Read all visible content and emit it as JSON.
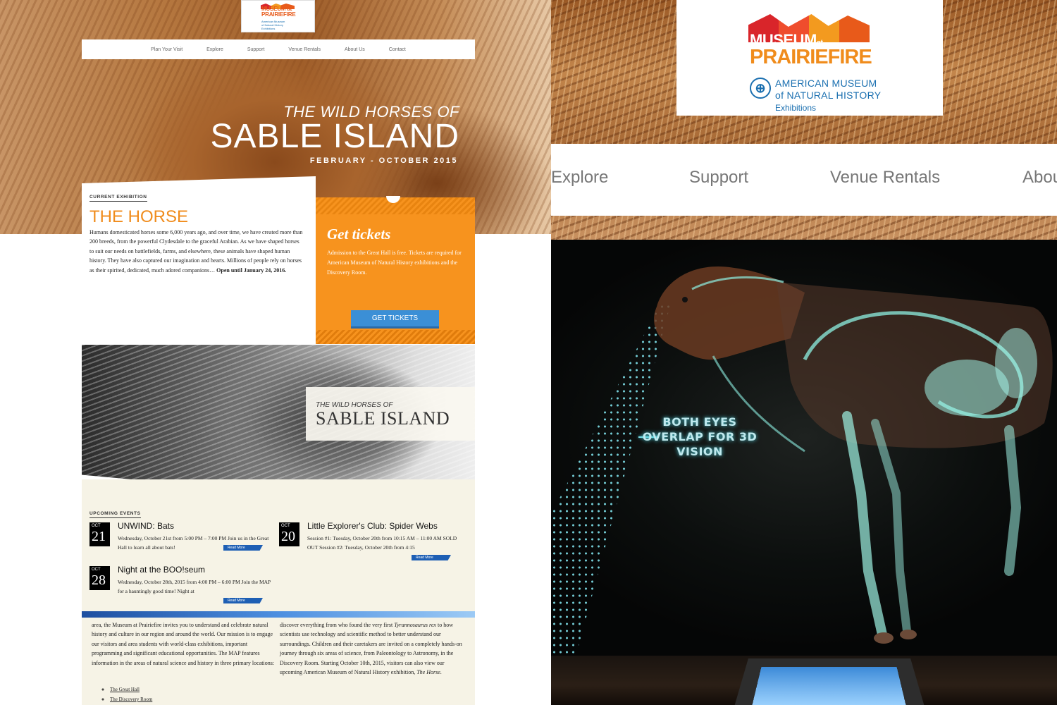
{
  "left": {
    "logo": {
      "museum": "MUSEUM",
      "at": "at",
      "prairiefire": "PRAIRIEFIRE",
      "amnh_line1": "American Museum",
      "amnh_line2": "of Natural History",
      "amnh_line3": "Exhibitions"
    },
    "nav": [
      "Plan Your Visit",
      "Explore",
      "Support",
      "Venue Rentals",
      "About Us",
      "Contact"
    ],
    "hero": {
      "subtitle": "THE WILD HORSES OF",
      "title": "SABLE ISLAND",
      "dates": "FEBRUARY - OCTOBER 2015"
    },
    "exhibition": {
      "label": "CURRENT EXHIBITION",
      "title": "THE HORSE",
      "body": "Humans domesticated horses some 6,000 years ago, and over time, we have created more than 200 breeds, from the powerful Clydesdale to the graceful Arabian. As we have shaped horses to suit our needs on battlefields, farms, and elsewhere, these animals have shaped human history. They have also captured our imagination and hearts. Millions of people rely on horses as their spirited, dedicated, much adored companions…",
      "closing": "Open until January 24, 2016."
    },
    "tickets": {
      "title": "Get tickets",
      "body": "Admission to the Great Hall is free. Tickets are required for American Museum of Natural History exhibitions and the Discovery Room.",
      "button": "GET TICKETS"
    },
    "sable_banner": {
      "subtitle": "THE WILD HORSES OF",
      "title": "SABLE ISLAND"
    },
    "events": {
      "label": "UPCOMING EVENTS",
      "items": [
        {
          "month": "OCT",
          "day": "21",
          "title": "UNWIND: Bats",
          "desc": "Wednesday, October 21st from 5:00 PM – 7:00 PM Join us in the Great Hall to learn all about bats!",
          "more": "Read More"
        },
        {
          "month": "OCT",
          "day": "20",
          "title": "Little Explorer's Club: Spider Webs",
          "desc": "Session #1: Tuesday, October 20th from 10:15 AM – 11:00 AM SOLD OUT Session #2: Tuesday, October 20th from 4:15",
          "more": "Read More"
        },
        {
          "month": "OCT",
          "day": "28",
          "title": "Night at the BOO!seum",
          "desc": "Wednesday, October 28th, 2015 from 4:00 PM – 6:00 PM Join the MAP for a hauntingly good time! Night at",
          "more": "Read More"
        }
      ]
    },
    "intro": {
      "col1": "area, the Museum at Prairiefire invites you to understand and celebrate natural history and culture in our region and around the world. Our mission is to engage our visitors and area students with world-class exhibitions, important programming and significant educational opportunities. The MAP features information in the areas of natural science and history in three primary locations:",
      "col2_a": "discover everything from who found the very first",
      "col2_b": "Tyrannosaurus rex",
      "col2_c": "to how scientists use technology and scientific method to better understand our surroundings. Children and their caretakers are invited on a completely hands-on journey through six areas of science, from Paleontology to Astronomy, in the Discovery Room. Starting October 10th, 2015, visitors can also view our upcoming American Museum of Natural History exhibition,",
      "col2_d": "The Horse",
      "col2_e": ".",
      "list": [
        "The Great Hall",
        "The Discovery Room"
      ]
    }
  },
  "right": {
    "logo": {
      "museum": "MUSEUM",
      "at": "at",
      "prairiefire": "PRAIRIEFIRE",
      "amnh_line1": "AMERICAN MUSEUM",
      "amnh_line2": "of NATURAL HISTORY",
      "amnh_line3": "Exhibitions"
    },
    "nav": [
      "Explore",
      "Support",
      "Venue Rentals",
      "Abou"
    ],
    "caption": "BOTH EYES OVERLAP FOR 3D VISION"
  }
}
